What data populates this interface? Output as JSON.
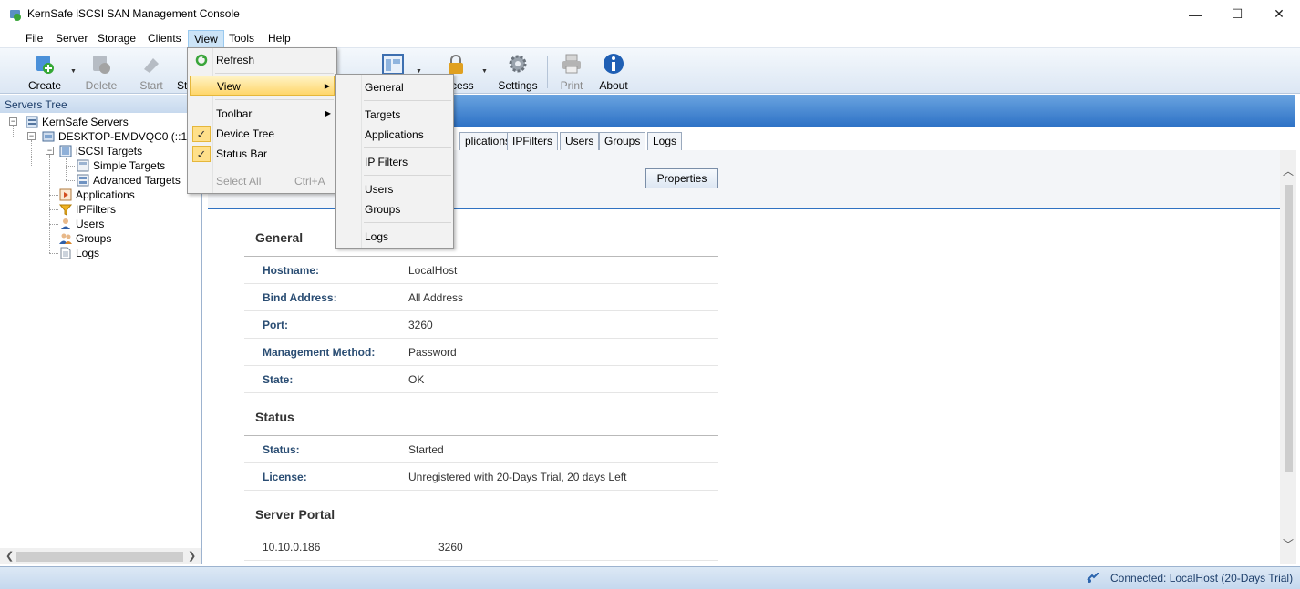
{
  "window": {
    "title": "KernSafe iSCSI SAN Management Console",
    "minimize": "—",
    "maximize": "☐",
    "close": "✕"
  },
  "menubar": [
    "File",
    "Server",
    "Storage",
    "Clients",
    "View",
    "Tools",
    "Help"
  ],
  "toolbar": {
    "create": "Create",
    "delete": "Delete",
    "start": "Start",
    "stop_partial": "St",
    "access_partial": "cess",
    "settings": "Settings",
    "print": "Print",
    "about": "About"
  },
  "left_pane": {
    "header": "Servers Tree",
    "tree": {
      "root": "KernSafe Servers",
      "server": "DESKTOP-EMDVQC0 (::1:32",
      "iscsi_targets": "iSCSI Targets",
      "simple_targets": "Simple Targets",
      "advanced_targets": "Advanced Targets",
      "applications": "Applications",
      "ipfilters": "IPFilters",
      "users": "Users",
      "groups": "Groups",
      "logs": "Logs"
    }
  },
  "tabs": [
    "plications",
    "IPFilters",
    "Users",
    "Groups",
    "Logs"
  ],
  "properties_button": "Properties",
  "general": {
    "title": "General",
    "rows": [
      {
        "key": "Hostname:",
        "value": "LocalHost"
      },
      {
        "key": "Bind Address:",
        "value": "All Address"
      },
      {
        "key": "Port:",
        "value": "3260"
      },
      {
        "key": "Management Method:",
        "value": "Password"
      },
      {
        "key": "State:",
        "value": "OK"
      }
    ]
  },
  "status": {
    "title": "Status",
    "rows": [
      {
        "key": "Status:",
        "value": "Started"
      },
      {
        "key": "License:",
        "value": "Unregistered with 20-Days Trial, 20 days Left"
      }
    ]
  },
  "server_portal": {
    "title": "Server Portal",
    "address": "10.10.0.186",
    "port": "3260"
  },
  "statusbar": {
    "connection": "Connected: LocalHost (20-Days Trial)"
  },
  "view_menu": {
    "refresh": "Refresh",
    "view": "View",
    "toolbar": "Toolbar",
    "device_tree": "Device Tree",
    "status_bar": "Status Bar",
    "select_all": "Select All",
    "select_all_shortcut": "Ctrl+A",
    "check_mark": "✓"
  },
  "view_submenu": [
    "General",
    "Targets",
    "Applications",
    "IP Filters",
    "Users",
    "Groups",
    "Logs"
  ],
  "colors": {
    "header_blue": "#2e72c6",
    "menu_highlight": "#ffd66b",
    "label_blue": "#2a4d73"
  }
}
